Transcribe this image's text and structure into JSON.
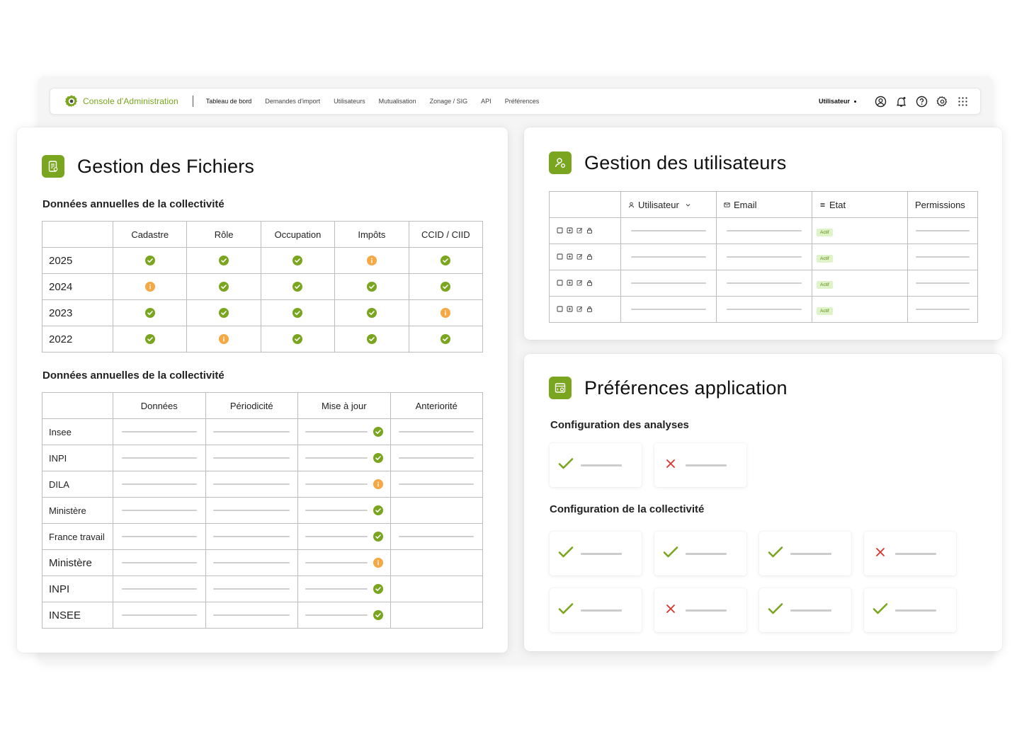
{
  "navbar": {
    "brand": "Console d'Administration",
    "links": [
      "Tableau de bord",
      "Demandes d'import",
      "Utilisateurs",
      "Mutualisation",
      "Zonage / SIG",
      "API",
      "Préférences"
    ],
    "user_label": "Utilisateur",
    "icons": [
      "user-circle-icon",
      "bell-icon",
      "help-icon",
      "gear-icon",
      "apps-grid-icon"
    ]
  },
  "files_card": {
    "title": "Gestion des Fichiers",
    "section1_title": "Données annuelles de la collectivité",
    "table1": {
      "columns": [
        "Cadastre",
        "Rôle",
        "Occupation",
        "Impôts",
        "CCID / CIID"
      ],
      "rows": [
        {
          "label": "2025",
          "status": [
            "ok",
            "ok",
            "ok",
            "warn",
            "ok"
          ]
        },
        {
          "label": "2024",
          "status": [
            "warn",
            "ok",
            "ok",
            "ok",
            "ok"
          ]
        },
        {
          "label": "2023",
          "status": [
            "ok",
            "ok",
            "ok",
            "ok",
            "warn"
          ]
        },
        {
          "label": "2022",
          "status": [
            "ok",
            "warn",
            "ok",
            "ok",
            "ok"
          ]
        }
      ]
    },
    "section2_title": "Données annuelles de la collectivité",
    "table2": {
      "columns": [
        "Données",
        "Périodicité",
        "Mise à jour",
        "Anteriorité"
      ],
      "rows": [
        {
          "label": "Insee",
          "status": "ok",
          "anteriority": true,
          "small": true
        },
        {
          "label": "INPI",
          "status": "ok",
          "anteriority": true,
          "small": true
        },
        {
          "label": "DILA",
          "status": "warn",
          "anteriority": true,
          "small": true
        },
        {
          "label": "Ministère",
          "status": "ok",
          "anteriority": false,
          "small": true
        },
        {
          "label": "France travail",
          "status": "ok",
          "anteriority": true,
          "small": true
        },
        {
          "label": "Ministère",
          "status": "warn",
          "anteriority": false,
          "small": false
        },
        {
          "label": "INPI",
          "status": "ok",
          "anteriority": false,
          "small": false
        },
        {
          "label": "INSEE",
          "status": "ok",
          "anteriority": false,
          "small": false
        }
      ]
    }
  },
  "users_card": {
    "title": "Gestion des utilisateurs",
    "columns": {
      "user": "Utilisateur",
      "email": "Email",
      "state": "Etat",
      "permissions": "Permissions"
    },
    "rows": [
      {
        "state": "Actif"
      },
      {
        "state": "Actif"
      },
      {
        "state": "Actif"
      },
      {
        "state": "Actif"
      }
    ]
  },
  "prefs_card": {
    "title": "Préférences application",
    "analyses_title": "Configuration des analyses",
    "analyses": [
      "ok",
      "ko"
    ],
    "collectivite_title": "Configuration de la collectivité",
    "collectivite": [
      "ok",
      "ok",
      "ok",
      "ko",
      "ok",
      "ko",
      "ok",
      "ok"
    ]
  },
  "colors": {
    "accent": "#7aa51e",
    "warning": "#f5a843",
    "error": "#d9342b",
    "badge_bg": "#dff3c8"
  }
}
